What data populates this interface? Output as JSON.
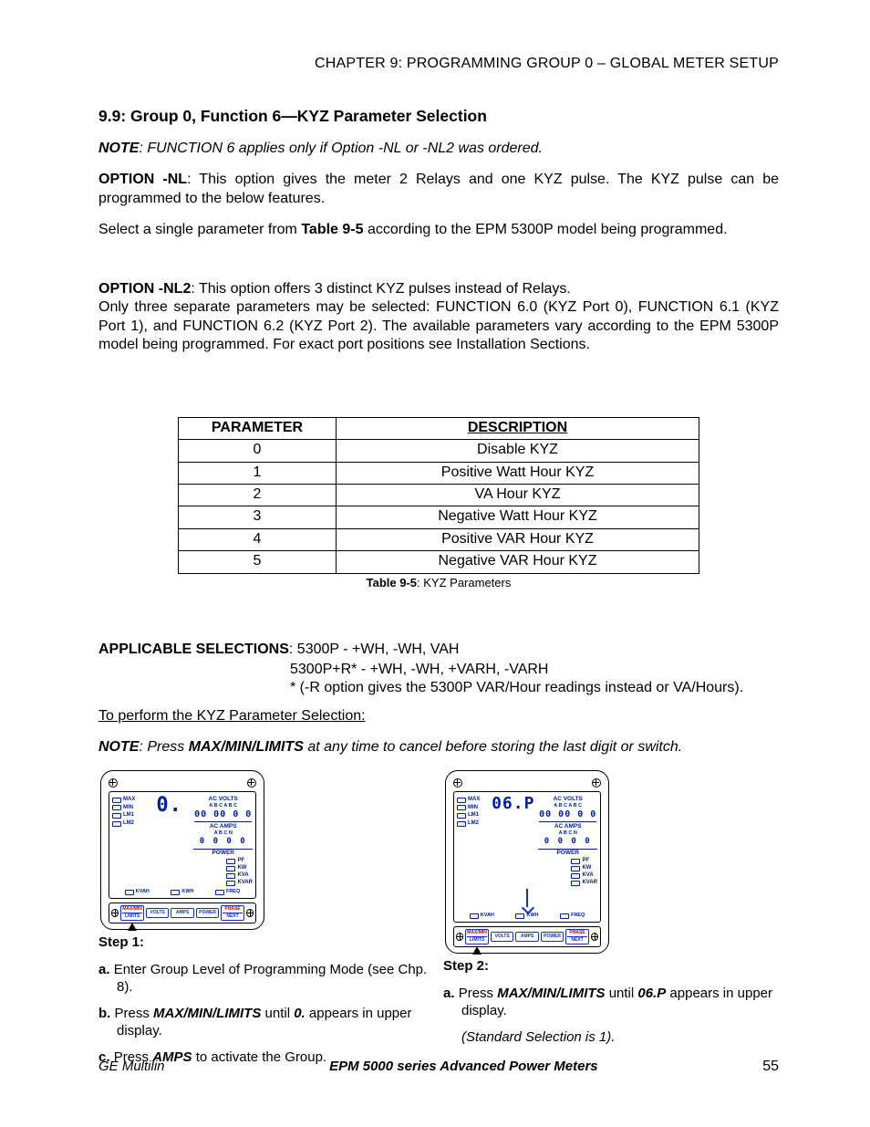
{
  "header": {
    "chapter_line": "CHAPTER 9: PROGRAMMING GROUP 0 – GLOBAL METER SETUP"
  },
  "section": {
    "title": "9.9: Group 0, Function 6—KYZ Parameter Selection"
  },
  "note1": {
    "prefix": "NOTE",
    "text": ": FUNCTION 6 applies only if Option -NL or -NL2 was ordered."
  },
  "optionNL": {
    "label": "OPTION -NL",
    "text": ": This option gives the meter 2 Relays and one KYZ pulse.  The KYZ pulse can be programmed to the below features."
  },
  "select_line": {
    "pre": "Select a single parameter from ",
    "bold": "Table 9-5",
    "post": " according to the EPM 5300P model being programmed."
  },
  "optionNL2": {
    "label": "OPTION -NL2",
    "line1_post": ": This option offers 3 distinct KYZ pulses instead of Relays.",
    "line2": "Only three separate parameters may be selected:  FUNCTION 6.0 (KYZ Port 0), FUNCTION 6.1 (KYZ Port 1), and FUNCTION 6.2 (KYZ Port 2). The available parameters vary according to the EPM 5300P model being programmed. For exact port positions see Installation Sections."
  },
  "table": {
    "headers": {
      "param": "PARAMETER",
      "desc": "DESCRIPTION"
    },
    "rows": [
      {
        "p": "0",
        "d": "Disable KYZ"
      },
      {
        "p": "1",
        "d": "Positive Watt Hour KYZ"
      },
      {
        "p": "2",
        "d": "VA Hour KYZ"
      },
      {
        "p": "3",
        "d": "Negative Watt Hour KYZ"
      },
      {
        "p": "4",
        "d": "Positive VAR Hour KYZ"
      },
      {
        "p": "5",
        "d": "Negative VAR Hour KYZ"
      }
    ],
    "caption_pre": "Table 9-5",
    "caption_post": ": KYZ Parameters"
  },
  "applicable": {
    "label": "APPLICABLE SELECTIONS",
    "line1_post": ":  5300P - +WH, -WH, VAH",
    "line2": "5300P+R* - +WH, -WH, +VARH, -VARH",
    "line3": "* (-R option gives the 5300P VAR/Hour readings instead or VA/Hours)."
  },
  "perform_line": "To perform the KYZ Parameter Selection:",
  "note2": {
    "prefix": "NOTE",
    "pre": ":  Press ",
    "boldit": "MAX/MIN/LIMITS",
    "post": " at any time to cancel before storing the last digit or switch."
  },
  "meter": {
    "left_display1": "0.",
    "left_display2": "06.P",
    "hdr_volts": "AC VOLTS",
    "hdr_amps": "AC AMPS",
    "hdr_power": "POWER",
    "abc_row1": "A  B  C  A  B  C",
    "digits_med": "00 00 0 0",
    "abc_row2": "A  B  C  N",
    "digits_sm": "0 0 0 0",
    "ind": {
      "max": "MAX",
      "min": "MIN",
      "lm1": "LM1",
      "lm2": "LM2"
    },
    "pwr": {
      "pf": "PF",
      "kw": "KW",
      "kva": "KVA",
      "kvar": "KVAR"
    },
    "bottom": {
      "kvah": "KVAH",
      "kwh": "KWH",
      "freq": "FREQ"
    },
    "buttons": {
      "maxmin": "MAX/MIN",
      "limits": "LIMITS",
      "volts": "VOLTS",
      "amps": "AMPS",
      "power": "POWER",
      "phase": "PHASE",
      "next": "NEXT"
    }
  },
  "steps": {
    "s1": {
      "label": "Step 1:",
      "a_pre": "a. ",
      "a_text": "Enter Group Level of Programming Mode (see Chp. 8).",
      "b_pre": "b. ",
      "b_text1": "Press ",
      "b_bold": "MAX/MIN/LIMITS",
      "b_text2": " until ",
      "b_boldit": "0.",
      "b_text3": " appears in upper display.",
      "c_pre": "c. ",
      "c_text1": "Press ",
      "c_bold": "AMPS",
      "c_text2": " to activate the Group."
    },
    "s2": {
      "label": "Step 2:",
      "a_pre": "a. ",
      "a_text1": "Press ",
      "a_bold": "MAX/MIN/LIMITS",
      "a_text2": " until ",
      "a_boldit": "06.P",
      "a_text3": " appears in upper display.",
      "std": "(Standard Selection is 1)."
    }
  },
  "footer": {
    "left": "GE Multilin",
    "mid": "EPM 5000 series Advanced Power Meters",
    "page": "55"
  }
}
